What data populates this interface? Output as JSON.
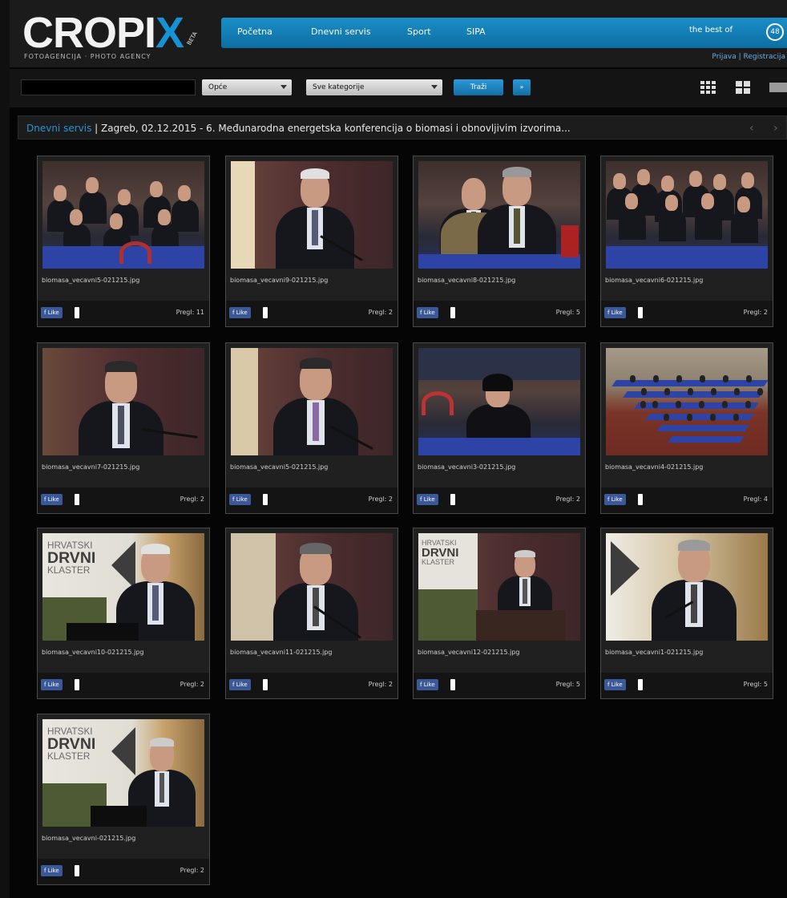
{
  "header": {
    "logo_text": "CROPI",
    "logo_x": "X",
    "logo_beta": "BETA",
    "logo_subtitle": "FOTOAGENCIJA  ·  PHOTO AGENCY",
    "nav": [
      "Početna",
      "Dnevni servis",
      "Sport",
      "SIPA"
    ],
    "best_of": "the best of",
    "badge": "48",
    "login_links": "Prijava | Registracija"
  },
  "search": {
    "input_value": "",
    "select_mode": "Opće",
    "select_category": "Sve kategorije",
    "search_button": "Traži",
    "advanced_button": "»"
  },
  "breadcrumb": {
    "section": "Dnevni servis",
    "separator": " | ",
    "title": "Zagreb, 02.12.2015 - 6. Međunarodna energetska konferencija o biomasi i obnovljivim izvorima..."
  },
  "colors": {
    "accent": "#1a8ec9",
    "link": "#2a94d6",
    "facebook": "#3b5998"
  },
  "icons": {
    "grid_small": "grid-small-icon",
    "grid_large": "grid-large-icon",
    "list": "list-icon",
    "prev": "chevron-left-icon",
    "next": "chevron-right-icon"
  },
  "photos": [
    {
      "file": "biomasa_vecavni5-021215.jpg",
      "like": "f Like",
      "views": "Pregl: 11",
      "scene": "crowd"
    },
    {
      "file": "biomasa_vecavni9-021215.jpg",
      "like": "f Like",
      "views": "Pregl: 2",
      "scene": "speaker-old"
    },
    {
      "file": "biomasa_vecavni8-021215.jpg",
      "like": "f Like",
      "views": "Pregl: 5",
      "scene": "audience-headphones"
    },
    {
      "file": "biomasa_vecavni6-021215.jpg",
      "like": "f Like",
      "views": "Pregl: 2",
      "scene": "crowd-wide"
    },
    {
      "file": "biomasa_vecavni7-021215.jpg",
      "like": "f Like",
      "views": "Pregl: 2",
      "scene": "speaker"
    },
    {
      "file": "biomasa_vecavni5-021215.jpg",
      "like": "f Like",
      "views": "Pregl: 2",
      "scene": "speaker-young"
    },
    {
      "file": "biomasa_vecavni3-021215.jpg",
      "like": "f Like",
      "views": "Pregl: 2",
      "scene": "woman"
    },
    {
      "file": "biomasa_vecavni4-021215.jpg",
      "like": "f Like",
      "views": "Pregl: 4",
      "scene": "hall"
    },
    {
      "file": "biomasa_vecavni10-021215.jpg",
      "like": "f Like",
      "views": "Pregl: 2",
      "scene": "banner-speaker"
    },
    {
      "file": "biomasa_vecavni11-021215.jpg",
      "like": "f Like",
      "views": "Pregl: 2",
      "scene": "speaker-headset"
    },
    {
      "file": "biomasa_vecavni12-021215.jpg",
      "like": "f Like",
      "views": "Pregl: 5",
      "scene": "banner-podium"
    },
    {
      "file": "biomasa_vecavni1-021215.jpg",
      "like": "f Like",
      "views": "Pregl: 5",
      "scene": "speaker-grey"
    },
    {
      "file": "biomasa_vecavni-021215.jpg",
      "like": "f Like",
      "views": "Pregl: 2",
      "scene": "banner-podium2"
    }
  ],
  "banner_text": {
    "line1": "HRVATSKI",
    "line2": "DRVNI",
    "line3": "KLASTER"
  }
}
